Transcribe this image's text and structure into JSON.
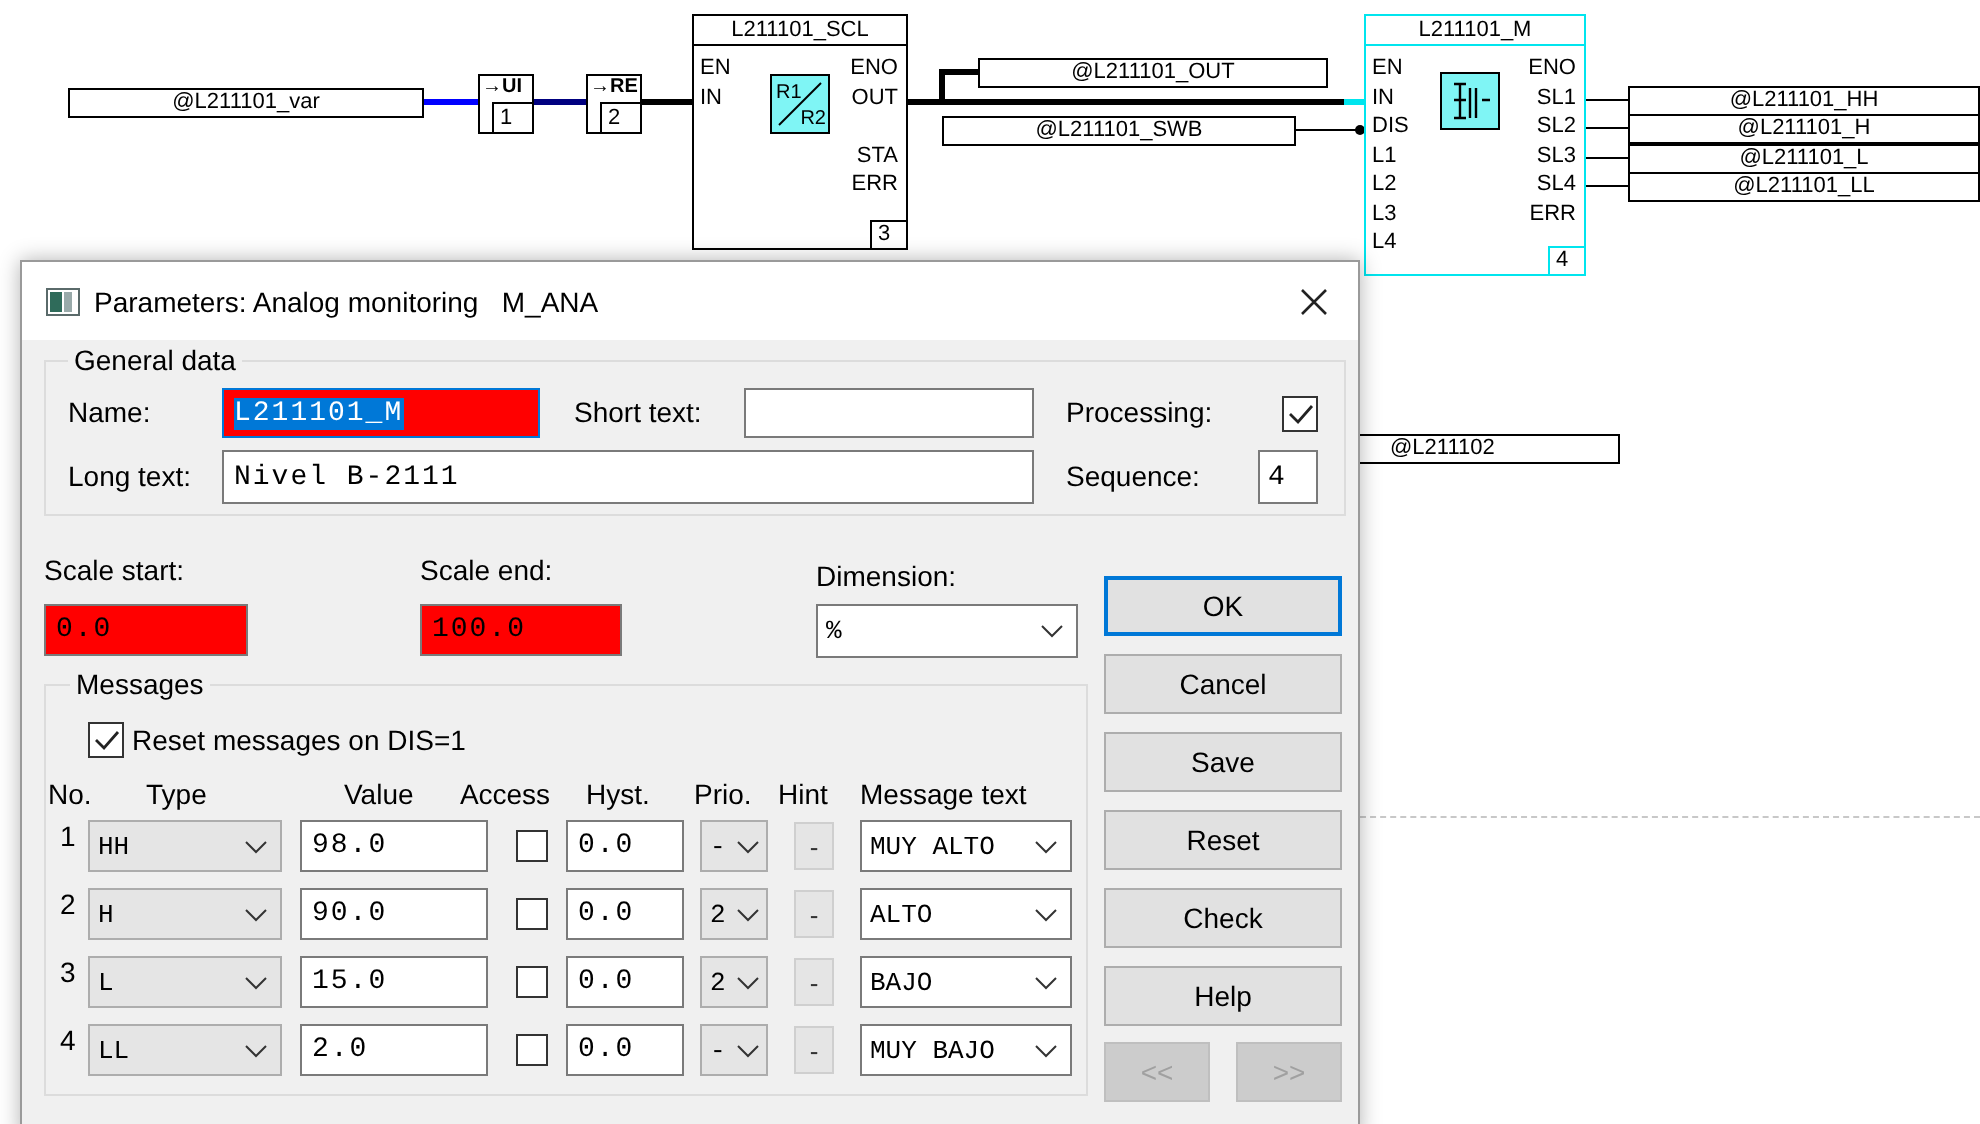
{
  "diagram": {
    "input_tag": {
      "text": "@L211101_var"
    },
    "converters": [
      {
        "label": "→UI",
        "number": "1"
      },
      {
        "label": "→RE",
        "number": "2"
      }
    ],
    "blocks": [
      {
        "kind": "scaling",
        "title": "L211101_SCL",
        "inputs": [
          "EN",
          "IN"
        ],
        "outputs": [
          "ENO",
          "OUT",
          "STA",
          "ERR"
        ],
        "symbol_labels": [
          "R1",
          "R2"
        ],
        "number": "3",
        "selected": false
      },
      {
        "kind": "monitor",
        "title": "L211101_M",
        "inputs": [
          "EN",
          "IN",
          "DIS",
          "L1",
          "L2",
          "L3",
          "L4"
        ],
        "outputs": [
          "ENO",
          "SL1",
          "SL2",
          "SL3",
          "SL4",
          "ERR"
        ],
        "number": "4",
        "selected": true
      }
    ],
    "tags": [
      {
        "text": "@L211101_OUT"
      },
      {
        "text": "@L211101_SWB"
      },
      {
        "text": "@L211101_HH"
      },
      {
        "text": "@L211101_H"
      },
      {
        "text": "@L211101_L"
      },
      {
        "text": "@L211101_LL"
      },
      {
        "text": "@L211102"
      }
    ]
  },
  "dialog": {
    "title": "Parameters: Analog monitoring   M_ANA",
    "general": {
      "legend": "General data",
      "name_label": "Name:",
      "name": {
        "value": "L211101_M",
        "error": true,
        "text_selected": true
      },
      "short_text_label": "Short text:",
      "short_text": {
        "error": false
      },
      "processing_label": "Processing:",
      "processing": true,
      "long_text_label": "Long text:",
      "long_text": {
        "value": "Nivel B-2111",
        "error": false
      },
      "sequence_label": "Sequence:",
      "sequence": {
        "value": "4",
        "error": false
      }
    },
    "scale": [
      {
        "label": "Scale start:",
        "value": "0.0",
        "error": true
      },
      {
        "label": "Scale end:",
        "value": "100.0",
        "error": true
      }
    ],
    "dimension": {
      "label": "Dimension:",
      "value": "%"
    },
    "messages": {
      "legend": "Messages",
      "reset_label": "Reset messages on DIS=1",
      "reset_checked": true,
      "columns": [
        "No.",
        "Type",
        "Value",
        "Access",
        "Hyst.",
        "Prio.",
        "Hint",
        "Message text"
      ],
      "rows": [
        {
          "no": "1",
          "type": "HH",
          "value": "98.0",
          "access": false,
          "hyst": "0.0",
          "prio": "-",
          "hint": "-",
          "message": "MUY ALTO"
        },
        {
          "no": "2",
          "type": "H",
          "value": "90.0",
          "access": false,
          "hyst": "0.0",
          "prio": "2",
          "hint": "-",
          "message": "ALTO"
        },
        {
          "no": "3",
          "type": "L",
          "value": "15.0",
          "access": false,
          "hyst": "0.0",
          "prio": "2",
          "hint": "-",
          "message": "BAJO"
        },
        {
          "no": "4",
          "type": "LL",
          "value": "2.0",
          "access": false,
          "hyst": "0.0",
          "prio": "-",
          "hint": "-",
          "message": "MUY BAJO"
        }
      ]
    },
    "buttons": [
      {
        "label": "OK",
        "default": true,
        "disabled": false
      },
      {
        "label": "Cancel",
        "default": false,
        "disabled": false
      },
      {
        "label": "Save",
        "default": false,
        "disabled": false
      },
      {
        "label": "Reset",
        "default": false,
        "disabled": false
      },
      {
        "label": "Check",
        "default": false,
        "disabled": false
      },
      {
        "label": "Help",
        "default": false,
        "disabled": false
      }
    ],
    "nav_buttons": [
      {
        "label": "<<",
        "disabled": true
      },
      {
        "label": ">>",
        "disabled": true
      }
    ]
  }
}
